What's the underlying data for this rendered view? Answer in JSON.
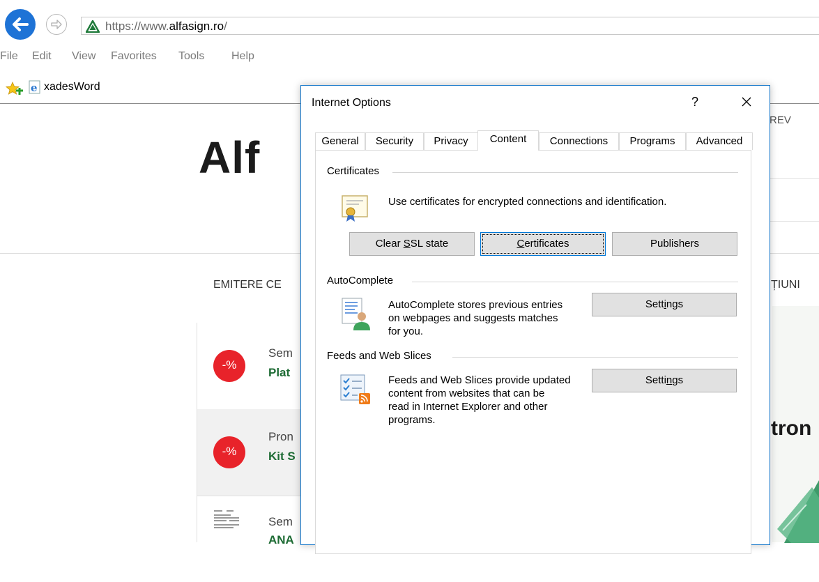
{
  "browser": {
    "url_scheme": "https://www.",
    "url_host": "alfasign.ro",
    "url_path": "/",
    "menu": [
      "File",
      "Edit",
      "View",
      "Favorites",
      "Tools",
      "Help"
    ],
    "favorites": [
      {
        "label": "xadesWord",
        "icon": "ie-page-icon"
      }
    ]
  },
  "page": {
    "top_link": "REV",
    "logo": "Alf",
    "nav_left": "EMITERE CE",
    "nav_right": "ȚIUNI",
    "side_title": "tron",
    "promos": [
      {
        "badge": "-%",
        "kicker": "Sem",
        "title": "Plat"
      },
      {
        "badge": "-%",
        "kicker": "Pron",
        "title": "Kit S"
      },
      {
        "badge": "",
        "kicker": "Sem",
        "title": "ANA"
      }
    ],
    "accent_red": "#e8232a",
    "accent_green": "#1d6b34"
  },
  "dialog": {
    "title": "Internet Options",
    "help": "?",
    "tabs": [
      "General",
      "Security",
      "Privacy",
      "Content",
      "Connections",
      "Programs",
      "Advanced"
    ],
    "active_tab": "Content",
    "certificates": {
      "heading": "Certificates",
      "description": "Use certificates for encrypted connections and identification.",
      "clear_ssl_pre": "Clear ",
      "clear_ssl_u": "S",
      "clear_ssl_post": "SL state",
      "certificates_u": "C",
      "certificates_post": "ertificates",
      "publishers": "Publishers"
    },
    "autocomplete": {
      "heading": "AutoComplete",
      "lines": [
        "AutoComplete stores previous entries",
        "on webpages and suggests matches",
        "for you."
      ],
      "settings_pre": "Sett",
      "settings_u": "i",
      "settings_post": "ngs"
    },
    "feeds": {
      "heading": "Feeds and Web Slices",
      "lines": [
        "Feeds and Web Slices provide updated",
        "content from websites that can be",
        "read in Internet Explorer and other",
        "programs."
      ],
      "settings_pre": "Setti",
      "settings_u": "n",
      "settings_post": "gs"
    }
  }
}
